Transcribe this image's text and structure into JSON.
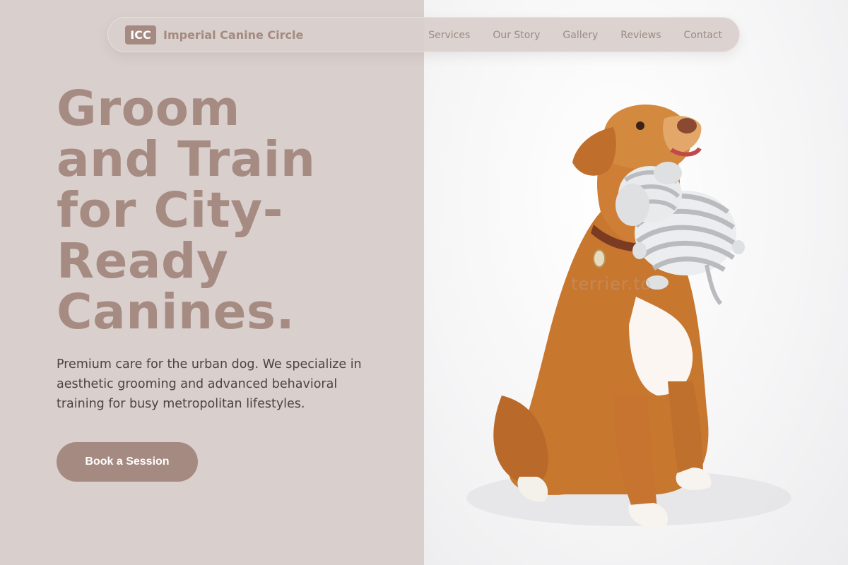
{
  "brand": {
    "badge": "ICC",
    "name": "Imperial Canine Circle"
  },
  "nav": [
    "Services",
    "Our Story",
    "Gallery",
    "Reviews",
    "Contact"
  ],
  "hero": {
    "title_lines": [
      "Groom",
      "and Train",
      "for City-",
      "Ready",
      "Canines."
    ],
    "description": "Premium care for the urban dog. We specialize in aesthetic grooming and advanced behavioral training for busy metropolitan lifestyles.",
    "cta": "Book a Session"
  },
  "photo": {
    "watermark": "terrier.to"
  },
  "colors": {
    "accent": "#a58a81",
    "panel": "#d9cfcc",
    "text": "#4a4443"
  }
}
